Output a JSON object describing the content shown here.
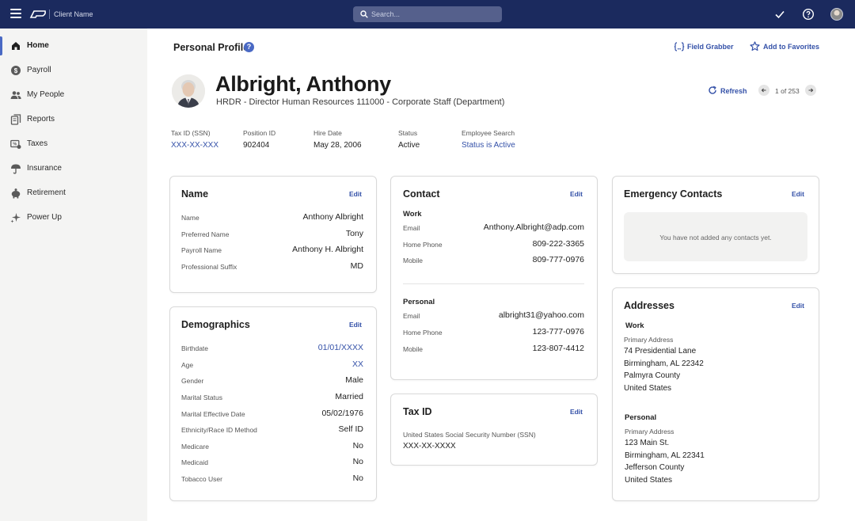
{
  "topbar": {
    "client_name": "Client Name",
    "search_placeholder": "Search..."
  },
  "sidebar": {
    "items": [
      {
        "label": "Home",
        "icon": "home-icon"
      },
      {
        "label": "Payroll",
        "icon": "dollar-icon"
      },
      {
        "label": "My People",
        "icon": "people-icon"
      },
      {
        "label": "Reports",
        "icon": "reports-icon"
      },
      {
        "label": "Taxes",
        "icon": "taxes-icon"
      },
      {
        "label": "Insurance",
        "icon": "umbrella-icon"
      },
      {
        "label": "Retirement",
        "icon": "piggy-bank-icon"
      },
      {
        "label": "Power Up",
        "icon": "sparkle-icon"
      }
    ]
  },
  "header": {
    "title": "Personal Profile",
    "help": "?",
    "field_grabber": "Field Grabber",
    "add_favorites": "Add to Favorites"
  },
  "employee": {
    "name": "Albright, Anthony",
    "job": "HRDR - Director Human Resources 111000 - Corporate Staff (Department)",
    "refresh": "Refresh",
    "pager": "1 of 253"
  },
  "stats": [
    {
      "label": "Tax ID (SSN)",
      "value": "XXX-XX-XXX"
    },
    {
      "label": "Position ID",
      "value": "902404"
    },
    {
      "label": "Hire Date",
      "value": "May 28, 2006"
    },
    {
      "label": "Status",
      "value": "Active"
    },
    {
      "label": "Employee Search",
      "value": "Status is Active"
    }
  ],
  "name_card": {
    "title": "Name",
    "edit": "Edit",
    "rows": [
      {
        "label": "Name",
        "value": "Anthony Albright"
      },
      {
        "label": "Preferred Name",
        "value": "Tony"
      },
      {
        "label": "Payroll Name",
        "value": "Anthony H. Albright"
      },
      {
        "label": "Professional Suffix",
        "value": "MD"
      }
    ]
  },
  "demographics_card": {
    "title": "Demographics",
    "edit": "Edit",
    "rows": [
      {
        "label": "Birthdate",
        "value": "01/01/XXXX"
      },
      {
        "label": "Age",
        "value": "XX"
      },
      {
        "label": "Gender",
        "value": "Male"
      },
      {
        "label": "Marital Status",
        "value": "Married"
      },
      {
        "label": "Marital Effective Date",
        "value": "05/02/1976"
      },
      {
        "label": "Ethnicity/Race ID Method",
        "value": "Self ID"
      },
      {
        "label": "Medicare",
        "value": "No"
      },
      {
        "label": "Medicaid",
        "value": "No"
      },
      {
        "label": "Tobacco User",
        "value": "No"
      }
    ]
  },
  "contact_card": {
    "title": "Contact",
    "edit": "Edit",
    "work": {
      "heading": "Work",
      "rows": [
        {
          "label": "Email",
          "value": "Anthony.Albright@adp.com"
        },
        {
          "label": "Home Phone",
          "value": "809-222-3365"
        },
        {
          "label": "Mobile",
          "value": "809-777-0976"
        }
      ]
    },
    "personal": {
      "heading": "Personal",
      "rows": [
        {
          "label": "Email",
          "value": "albright31@yahoo.com"
        },
        {
          "label": "Home Phone",
          "value": "123-777-0976"
        },
        {
          "label": "Mobile",
          "value": "123-807-4412"
        }
      ]
    }
  },
  "taxid_card": {
    "title": "Tax ID",
    "edit": "Edit",
    "label": "United States Social Security Number (SSN)",
    "value": "XXX-XX-XXXX"
  },
  "emergency_card": {
    "title": "Emergency Contacts",
    "edit": "Edit",
    "empty": "You have not added any contacts yet."
  },
  "addresses_card": {
    "title": "Addresses",
    "edit": "Edit",
    "work": {
      "heading": "Work",
      "label": "Primary Address",
      "lines": [
        "74 Presidential Lane",
        "Birmingham, AL 22342",
        "Palmyra County",
        "United States"
      ]
    },
    "personal": {
      "heading": "Personal",
      "label": "Primary Address",
      "lines": [
        "123 Main St.",
        "Birmingham, AL 22341",
        "Jefferson County",
        "United States"
      ]
    }
  },
  "colors": {
    "topbar": "#1b2a5e",
    "accent": "#3451a8",
    "sidebar": "#f4f4f3"
  }
}
